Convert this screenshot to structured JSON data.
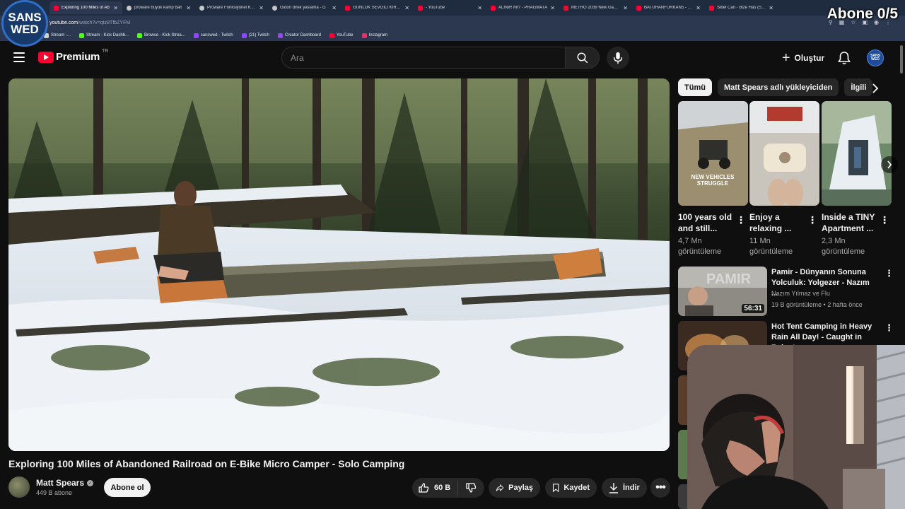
{
  "browser": {
    "tabs": [
      {
        "title": "Exploring 100 Miles of Ab",
        "active": true,
        "icon": "youtube-favicon"
      },
      {
        "title": "proware büyük kamp balt",
        "active": false,
        "icon": "globe-favicon"
      },
      {
        "title": "Proware Fonksiyonel Kam",
        "active": false,
        "icon": "globe-favicon"
      },
      {
        "title": "Gidon direk yaslama - G",
        "active": false,
        "icon": "globe-favicon"
      },
      {
        "title": "GÜNLÜK SEVGİLİ KİRALA",
        "active": false,
        "icon": "youtube-favicon"
      },
      {
        "title": "- YouTube",
        "active": false,
        "icon": "youtube-favicon"
      },
      {
        "title": "ALINIR MI? - PRAGMATA",
        "active": false,
        "icon": "youtube-favicon"
      },
      {
        "title": "METRO 2039 New Gamep",
        "active": false,
        "icon": "youtube-favicon"
      },
      {
        "title": "BATUHANFURKAN5 - HÜ",
        "active": false,
        "icon": "youtube-favicon"
      },
      {
        "title": "Sibel Can - Bize Has (Slow",
        "active": false,
        "icon": "youtube-favicon"
      }
    ],
    "url": {
      "host": "youtube.com",
      "path": "/watch?v=qtz8TfbZYFM"
    },
    "bookmarks": [
      {
        "label": "Stream -...",
        "color": "#cfcfcf"
      },
      {
        "label": "Stream - Kick Dashb...",
        "color": "#53fc18"
      },
      {
        "label": "Browse - Kick Strea...",
        "color": "#53fc18"
      },
      {
        "label": "sanswed - Twitch",
        "color": "#9146ff"
      },
      {
        "label": "(21) Twitch",
        "color": "#9146ff"
      },
      {
        "label": "Creator Dashboard",
        "color": "#9146ff"
      },
      {
        "label": "YouTube",
        "color": "#ff0033"
      },
      {
        "label": "Instagram",
        "color": "#e1306c"
      }
    ]
  },
  "overlay": {
    "logo_line1": "SANS",
    "logo_line2": "WED",
    "abone_counter": "Abone 0/5"
  },
  "header": {
    "brand": "Premium",
    "country": "TR",
    "search_placeholder": "Ara",
    "create_label": "Oluştur",
    "avatar_text": "SANS WED"
  },
  "video": {
    "title": "Exploring 100 Miles of Abandoned Railroad on E-Bike Micro Camper - Solo Camping",
    "channel": "Matt Spears",
    "subscribers": "449 B abone",
    "subscribe_label": "Abone ol",
    "likes": "60 B",
    "share_label": "Paylaş",
    "save_label": "Kaydet",
    "download_label": "İndir"
  },
  "chips": [
    "Tümü",
    "Matt Spears adlı yükleyiciden",
    "İlgili"
  ],
  "shorts": [
    {
      "title": "100 years old and still...",
      "views_line1": "4,7 Mn",
      "views_line2": "görüntüleme"
    },
    {
      "title": "Enjoy a relaxing ...",
      "views_line1": "11 Mn",
      "views_line2": "görüntüleme"
    },
    {
      "title": "Inside a TINY Apartment ...",
      "views_line1": "2,3 Mn",
      "views_line2": "görüntüleme"
    }
  ],
  "short_overlay_text": {
    "line1": "NEW VEHICLES",
    "line2": "STRUGGLE"
  },
  "recommended": [
    {
      "title": "Pamir - Dünyanın Sonuna Yolculuk: Yolgezer - Nazım ...",
      "channel": "Nazım Yılmaz ve Flu",
      "meta": "19 B görüntüleme • 2 hafta önce",
      "duration": "56:31",
      "thumb_text": "PAMIR"
    },
    {
      "title": "Hot Tent Camping in Heavy Rain All Day! - Caught in Rainstorm ...",
      "channel": "",
      "meta": "",
      "duration": "",
      "thumb_text": ""
    }
  ]
}
